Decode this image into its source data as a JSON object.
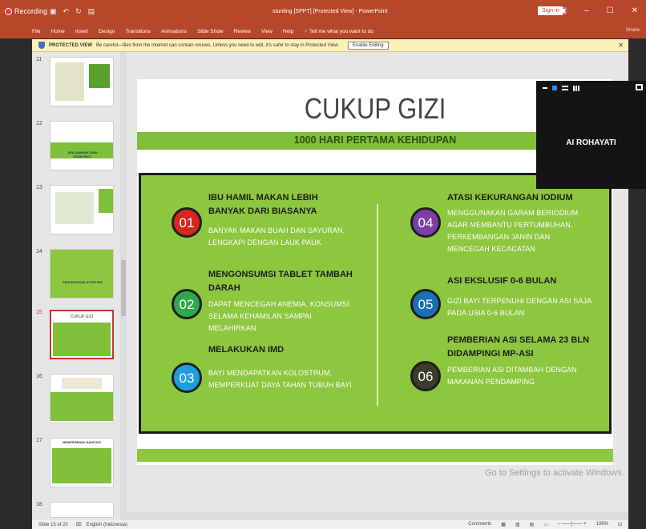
{
  "titlebar": {
    "recording_label": "Recording",
    "doc_title": "stunting [SPPT] [Protected View] - PowerPoint",
    "signin": "Sign in",
    "controls": [
      "▣",
      "–",
      "☐",
      "✕"
    ]
  },
  "ribbon": {
    "tabs": [
      "File",
      "Home",
      "Insert",
      "Design",
      "Transitions",
      "Animations",
      "Slide Show",
      "Review",
      "View",
      "Help",
      "Tell me what you want to do"
    ],
    "share": "Share"
  },
  "protected_view": {
    "label": "PROTECTED VIEW",
    "message": "Be careful—files from the Internet can contain viruses. Unless you need to edit, it's safer to stay in Protected View.",
    "button": "Enable Editing"
  },
  "thumbnails": {
    "numbers": [
      "11",
      "12",
      "13",
      "14",
      "15",
      "16",
      "17",
      "18"
    ],
    "texts": {
      "t12": "APA DAMPAK DARI STUNTING?",
      "t14": "PENCEGAHAN STUNTING",
      "t15": "CUKUP GIZI",
      "t17": "MEMPERBAIKI SANITASI"
    },
    "active": "15"
  },
  "slide": {
    "title": "CUKUP GIZI",
    "subtitle": "1000 HARI PERTAMA KEHIDUPAN",
    "items": [
      {
        "num": "01",
        "head": [
          "IBU HAMIL MAKAN LEBIH",
          "BANYAK DARI BIASANYA"
        ],
        "body": [
          "BANYAK MAKAN BUAH DAN SAYURAN,",
          "LENGKAPI DENGAN LAUK PAUK"
        ],
        "color": "#d7261e"
      },
      {
        "num": "02",
        "head": [
          "MENGONSUMSI TABLET TAMBAH",
          "DARAH"
        ],
        "body": [
          "DAPAT MENCEGAH ANEMIA, KONSUMSI",
          "SELAMA KEHAMILAN SAMPAI",
          "MELAHIRKAN"
        ],
        "color": "#2ea84a"
      },
      {
        "num": "03",
        "head": [
          "MELAKUKAN IMD"
        ],
        "body": [
          "BAYI MENDAPATKAN KOLOSTRUM,",
          "MEMPERKUAT DAYA TAHAN TUBUH BAYI"
        ],
        "color": "#1d9ee0"
      },
      {
        "num": "04",
        "head": [
          "ATASI KEKURANGAN IODIUM"
        ],
        "body": [
          "MENGGUNAKAN GARAM BERIODIUM",
          "AGAR MEMBANTU PERTUMBUHAN,",
          "PERKEMBANGAN JANIN DAN",
          "MENCEGAH KECACATAN"
        ],
        "color": "#7b3fa6"
      },
      {
        "num": "05",
        "head": [
          "ASI EKSLUSIF 0-6 BULAN"
        ],
        "body": [
          "GIZI BAYI TERPENUHI DENGAN ASI SAJA",
          "PADA USIA 0-6 BULAN"
        ],
        "color": "#1a6fb5"
      },
      {
        "num": "06",
        "head": [
          "PEMBERIAN ASI SELAMA 23 BLN",
          "DIDAMPINGI MP-ASI"
        ],
        "body": [
          "PEMBERIAN ASI DITAMBAH DENGAN",
          "MAKANAN PENDAMPING"
        ],
        "color": "#3c3c2a"
      }
    ]
  },
  "watermark": "Go to Settings to activate Windows.",
  "video": {
    "participant": "AI ROHAYATI"
  },
  "status": {
    "slide_info": "Slide 15 of 20",
    "language": "English (Indonesia)",
    "comments": "Comments",
    "zoom": "106%"
  }
}
